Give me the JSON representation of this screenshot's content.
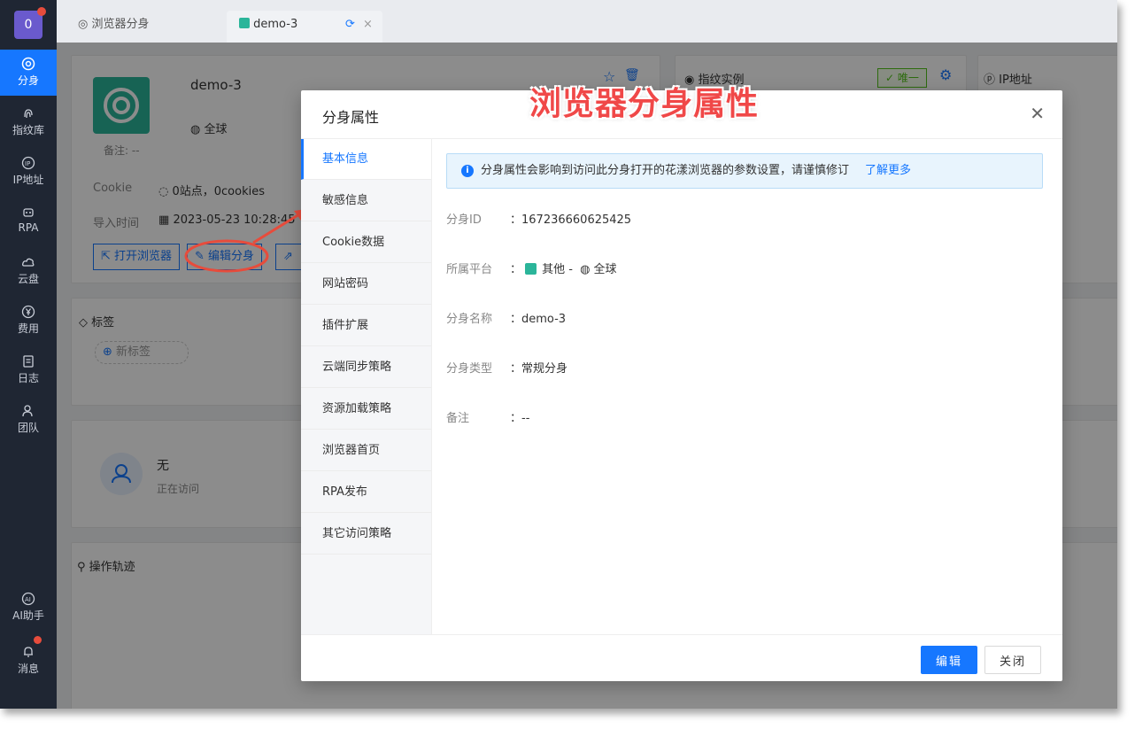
{
  "nav": {
    "logo_text": "0",
    "items": [
      {
        "label": "分身",
        "icon": "chrome-icon"
      },
      {
        "label": "指纹库",
        "icon": "fingerprint-icon"
      },
      {
        "label": "IP地址",
        "icon": "ip-icon"
      },
      {
        "label": "RPA",
        "icon": "robot-icon"
      },
      {
        "label": "云盘",
        "icon": "cloud-icon"
      },
      {
        "label": "费用",
        "icon": "yen-icon"
      },
      {
        "label": "日志",
        "icon": "log-icon"
      },
      {
        "label": "团队",
        "icon": "team-icon"
      }
    ],
    "ai_label": "AI助手",
    "msg_label": "消息"
  },
  "tabs": {
    "tab1": "浏览器分身",
    "tab2": "demo-3"
  },
  "profile": {
    "name": "demo-3",
    "region": "全球",
    "note": "备注: --",
    "cookie_label": "Cookie",
    "cookie_value": "0站点，0cookies",
    "import_label": "导入时间",
    "import_value": "2023-05-23 10:28:45",
    "btn_open": "打开浏览器",
    "btn_edit": "编辑分身"
  },
  "bg_panels": {
    "fingerprint_title": "指纹实例",
    "unique_badge": "唯一",
    "ip_title": "IP地址",
    "tags_title": "标签",
    "new_tag": "新标签",
    "visit_none": "无",
    "visiting": "正在访问",
    "ops_title": "操作轨迹"
  },
  "annotation": "浏览器分身属性",
  "modal": {
    "title": "分身属性",
    "side_items": [
      "基本信息",
      "敏感信息",
      "Cookie数据",
      "网站密码",
      "插件扩展",
      "云端同步策略",
      "资源加载策略",
      "浏览器首页",
      "RPA发布",
      "其它访问策略"
    ],
    "info_text": "分身属性会影响到访问此分身打开的花漾浏览器的参数设置，请谨慎修订",
    "info_link": "了解更多",
    "fields": {
      "id_label": "分身ID",
      "id_value": "：167236660625425",
      "platform_label": "所属平台",
      "platform_value": "其他 -",
      "platform_region": "全球",
      "name_label": "分身名称",
      "name_value": "：demo-3",
      "type_label": "分身类型",
      "type_value": "：常规分身",
      "note_label": "备注",
      "note_value": "：--"
    },
    "btn_edit": "编辑",
    "btn_close": "关闭"
  },
  "colors": {
    "accent": "#1677ff",
    "annotation": "#f04848",
    "nav_bg": "#1f2633"
  }
}
